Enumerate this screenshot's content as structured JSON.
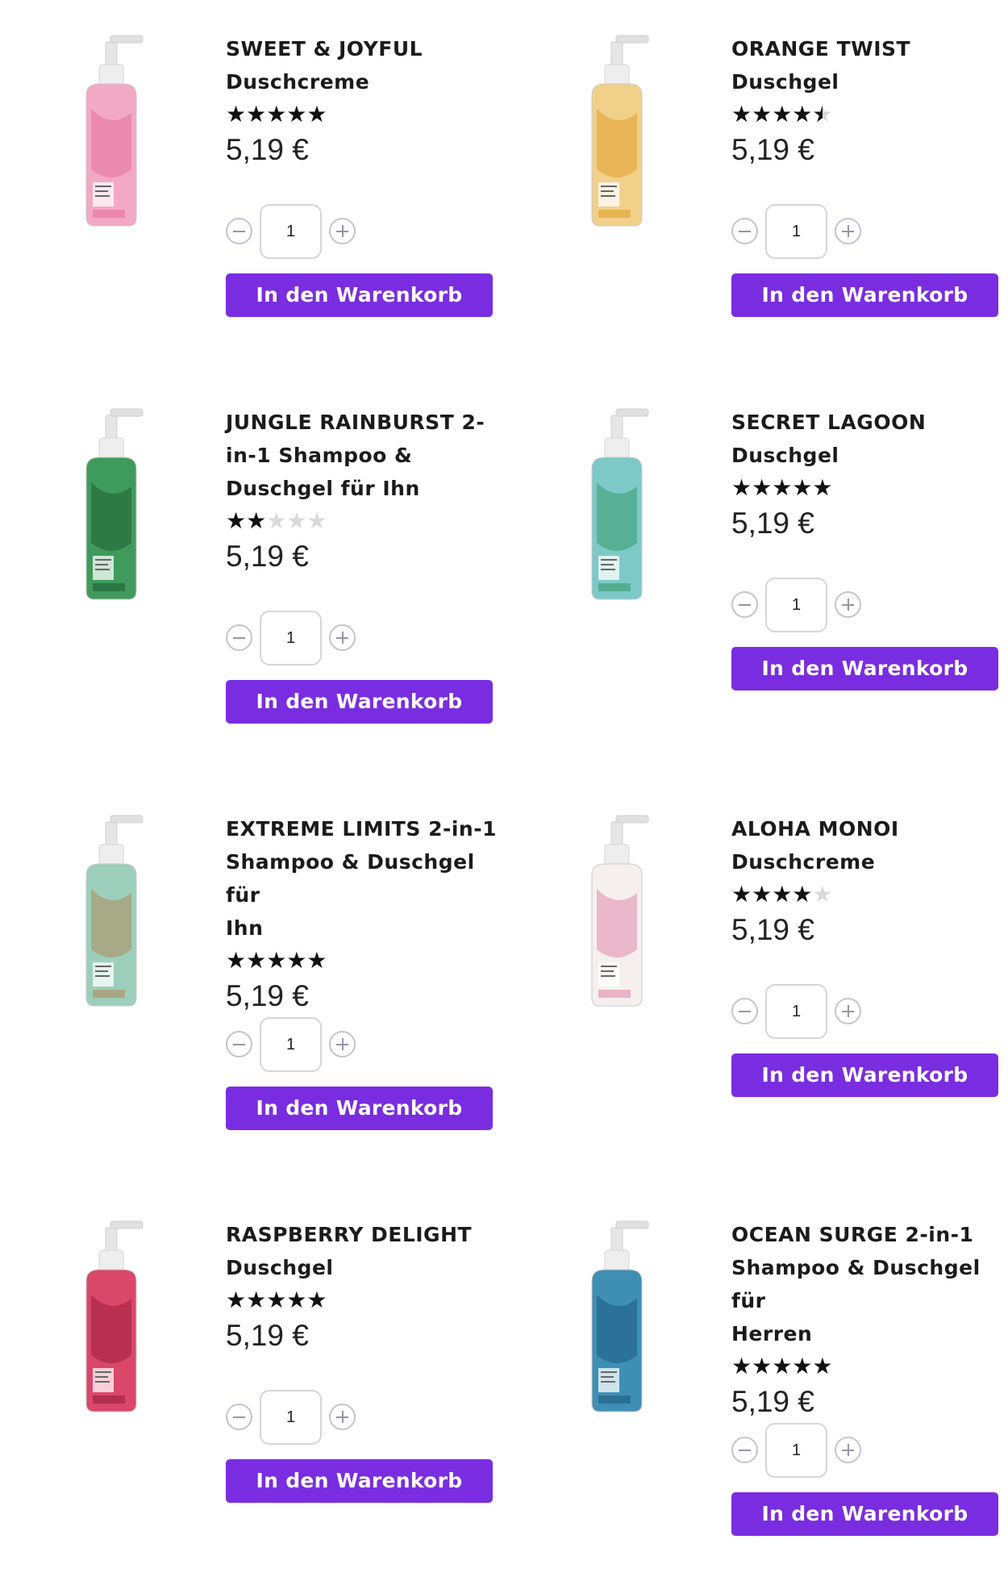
{
  "products": [
    {
      "name_line1": "SWEET & JOYFUL",
      "name_line2": "Duschcreme",
      "name_line3": "",
      "rating": 5,
      "price": "5,19 €",
      "quantity": "1",
      "cart_label": "In den Warenkorb",
      "bottle_color": "#f2a9c4",
      "bottle_accent": "#e7709c"
    },
    {
      "name_line1": "ORANGE TWIST",
      "name_line2": "Duschgel",
      "name_line3": "",
      "rating": 4.5,
      "price": "5,19 €",
      "quantity": "1",
      "cart_label": "In den Warenkorb",
      "bottle_color": "#f1d08a",
      "bottle_accent": "#e2a12e"
    },
    {
      "name_line1": "JUNGLE RAINBURST 2-",
      "name_line2": "in-1 Shampoo &",
      "name_line3": "Duschgel für Ihn",
      "rating": 2,
      "price": "5,19 €",
      "quantity": "1",
      "cart_label": "In den Warenkorb",
      "bottle_color": "#3f9b5c",
      "bottle_accent": "#1f5e35"
    },
    {
      "name_line1": "SECRET LAGOON",
      "name_line2": "Duschgel",
      "name_line3": "",
      "rating": 5,
      "price": "5,19 €",
      "quantity": "1",
      "cart_label": "In den Warenkorb",
      "bottle_color": "#7cc9c7",
      "bottle_accent": "#3b9a6a"
    },
    {
      "name_line1": "EXTREME LIMITS 2-in-1",
      "name_line2": "Shampoo & Duschgel für",
      "name_line3": "Ihn",
      "rating": 5,
      "price": "5,19 €",
      "quantity": "1",
      "cart_label": "In den Warenkorb",
      "bottle_color": "#9ccfbb",
      "bottle_accent": "#b38b5b"
    },
    {
      "name_line1": "ALOHA MONOI",
      "name_line2": "Duschcreme",
      "name_line3": "",
      "rating": 4,
      "price": "5,19 €",
      "quantity": "1",
      "cart_label": "In den Warenkorb",
      "bottle_color": "#f5f0ee",
      "bottle_accent": "#e289ad"
    },
    {
      "name_line1": "RASPBERRY DELIGHT",
      "name_line2": "Duschgel",
      "name_line3": "",
      "rating": 5,
      "price": "5,19 €",
      "quantity": "1",
      "cart_label": "In den Warenkorb",
      "bottle_color": "#d9476a",
      "bottle_accent": "#9a1d3c"
    },
    {
      "name_line1": "OCEAN SURGE 2-in-1",
      "name_line2": "Shampoo & Duschgel für",
      "name_line3": "Herren",
      "rating": 5,
      "price": "5,19 €",
      "quantity": "1",
      "cart_label": "In den Warenkorb",
      "bottle_color": "#3f8fb5",
      "bottle_accent": "#1d5a80"
    }
  ],
  "icons": {
    "minus": "minus-icon",
    "plus": "plus-icon",
    "star": "star-icon"
  },
  "colors": {
    "cart_button": "#7a2de0",
    "star_filled": "#111111",
    "star_empty": "#d9d9d9"
  }
}
